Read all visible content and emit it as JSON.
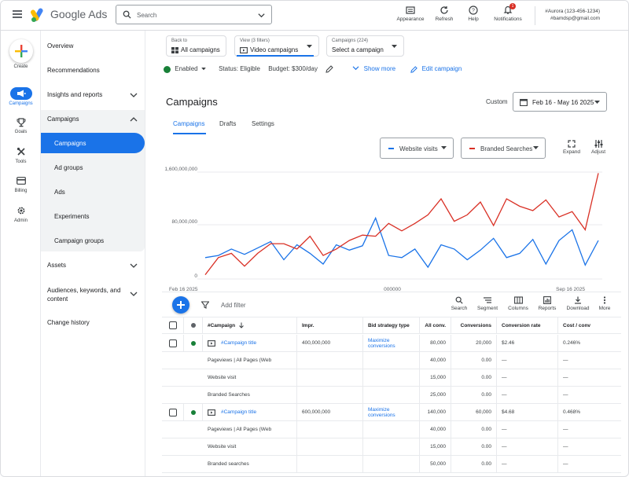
{
  "topbar": {
    "brand": "Google Ads",
    "search_placeholder": "Search",
    "tools": [
      {
        "label": "Appearance",
        "icon": "appearance-icon"
      },
      {
        "label": "Refresh",
        "icon": "refresh-icon"
      },
      {
        "label": "Help",
        "icon": "help-icon"
      },
      {
        "label": "Notifications",
        "icon": "bell-icon",
        "badge": "1"
      }
    ],
    "account_name": "#Aurora (123-456-1234)",
    "account_email": "#bamdsp@gmail.com"
  },
  "rail": {
    "items": [
      {
        "label": "Create",
        "icon": "plus-icon"
      },
      {
        "label": "Campaigns",
        "icon": "megaphone-icon",
        "active": true
      },
      {
        "label": "Goals",
        "icon": "trophy-icon"
      },
      {
        "label": "Tools",
        "icon": "tools-icon"
      },
      {
        "label": "Billing",
        "icon": "card-icon"
      },
      {
        "label": "Admin",
        "icon": "gear-icon"
      }
    ]
  },
  "nav": {
    "overview": "Overview",
    "recommendations": "Recommendations",
    "insights": "Insights and reports",
    "campaigns_group": "Campaigns",
    "sub": [
      "Campaigns",
      "Ad groups",
      "Ads",
      "Experiments",
      "Campaign groups"
    ],
    "assets": "Assets",
    "audiences_1": "Audiences, keywords, and",
    "audiences_2": "content",
    "change_history": "Change history"
  },
  "selectors": {
    "back_label": "Back to",
    "back_value": "All campaigns",
    "view_label": "View (3 filters)",
    "view_value": "Video campaigns",
    "campaigns_label": "Campaigns (224)",
    "campaigns_value": "Select a campaign"
  },
  "status": {
    "enabled": "Enabled",
    "status": "Status: Eligible",
    "budget": "Budget: $300/day",
    "show_more": "Show more",
    "edit_campaign": "Edit campaign"
  },
  "page": {
    "title": "Campaigns",
    "tabs": [
      "Campaigns",
      "Drafts",
      "Settings"
    ],
    "range_label": "Custom",
    "date_range": "Feb 16 - May 16 2025"
  },
  "chart_controls": {
    "metric_1": "Website visits",
    "metric_2": "Branded Searches",
    "expand": "Expand",
    "adjust": "Adjust",
    "color_1": "#1a73e8",
    "color_2": "#d93025"
  },
  "chart_data": {
    "type": "line",
    "y_tick_labels": [
      "1,600,000,000",
      "80,000,000",
      "0"
    ],
    "x_tick_labels": [
      "Feb 16 2025",
      "000000",
      "Sep 16 2025"
    ],
    "ylim": [
      0,
      1600000000
    ],
    "series": [
      {
        "name": "Website visits",
        "color": "#1a73e8",
        "values": [
          20,
          22,
          28,
          23,
          29,
          35,
          18,
          32,
          24,
          14,
          32,
          27,
          31,
          57,
          22,
          20,
          28,
          11,
          32,
          28,
          18,
          27,
          38,
          20,
          24,
          37,
          14,
          36,
          46,
          13,
          36
        ]
      },
      {
        "name": "Branded Searches",
        "color": "#d93025",
        "values": [
          4,
          20,
          24,
          12,
          24,
          33,
          33,
          28,
          40,
          22,
          28,
          36,
          41,
          40,
          52,
          45,
          52,
          60,
          75,
          54,
          60,
          72,
          50,
          75,
          68,
          64,
          74,
          58,
          63,
          46,
          99
        ]
      }
    ]
  },
  "table_toolbar": {
    "add_filter": "Add filter",
    "tools": [
      "Search",
      "Segment",
      "Columns",
      "Reports",
      "Download",
      "More"
    ]
  },
  "table": {
    "headers": [
      "#Campaign",
      "Impr.",
      "Bid strategy type",
      "All conv.",
      "Conversions",
      "Conversion rate",
      "Cost / conv"
    ],
    "rows": [
      {
        "type": "campaign",
        "name": "#Campaign title",
        "impr": "400,000,000",
        "bid_1": "Maximize",
        "bid_2": "conversions",
        "all_conv": "80,000",
        "conv": "20,000",
        "rate": "$2.46",
        "cost": "0.246%"
      },
      {
        "type": "seg",
        "name": "Pageviews | All Pages (Web",
        "all_conv": "40,000",
        "conv": "0.00",
        "rate": "—",
        "cost": "—"
      },
      {
        "type": "seg",
        "name": "Website visit",
        "all_conv": "15,000",
        "conv": "0.00",
        "rate": "—",
        "cost": "—"
      },
      {
        "type": "seg",
        "name": "Branded Searches",
        "all_conv": "25,000",
        "conv": "0.00",
        "rate": "—",
        "cost": "—"
      },
      {
        "type": "campaign",
        "name": "#Campaign title",
        "impr": "600,000,000",
        "bid_1": "Maximize",
        "bid_2": "conversions",
        "all_conv": "140,000",
        "conv": "60,000",
        "rate": "$4.68",
        "cost": "0.468%"
      },
      {
        "type": "seg",
        "name": "Pageviews | All Pages (Web",
        "all_conv": "40,000",
        "conv": "0.00",
        "rate": "—",
        "cost": "—"
      },
      {
        "type": "seg",
        "name": "Website visit",
        "all_conv": "15,000",
        "conv": "0.00",
        "rate": "—",
        "cost": "—"
      },
      {
        "type": "seg",
        "name": "Branded searches",
        "all_conv": "50,000",
        "conv": "0.00",
        "rate": "—",
        "cost": "—"
      }
    ]
  }
}
